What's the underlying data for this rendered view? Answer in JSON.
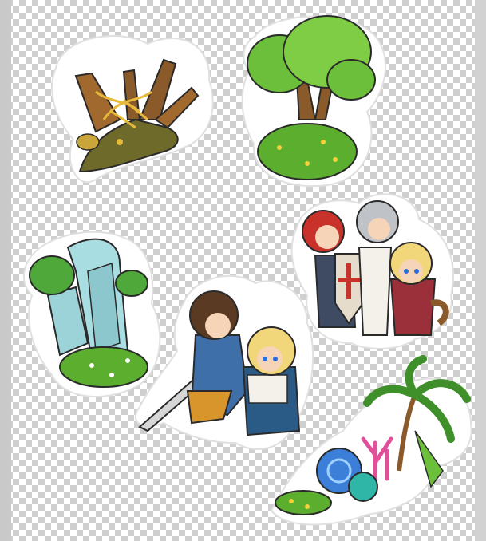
{
  "canvas": {
    "background": "transparency-checkerboard"
  },
  "stickers": [
    {
      "name": "dead-tree-stump-sticker",
      "icon": "withered-tree-icon"
    },
    {
      "name": "green-tree-bush-sticker",
      "icon": "tree-icon"
    },
    {
      "name": "knights-party-sticker",
      "icon": "characters-group-icon"
    },
    {
      "name": "overgrown-buildings-sticker",
      "icon": "ruined-skyscraper-icon"
    },
    {
      "name": "swordsman-and-girl-sticker",
      "icon": "adventurers-icon"
    },
    {
      "name": "coral-palm-sticker",
      "icon": "coral-reef-icon"
    }
  ],
  "colors": {
    "leaf": "#6cbf3a",
    "leaf_dark": "#3f8f2a",
    "bark": "#8a5a2b",
    "dead_wood": "#a2692f",
    "gold": "#e6b93b",
    "glass": "#9cd3d8",
    "hair_red": "#c8322b",
    "hair_silver": "#bfc3c8",
    "hair_blonde": "#f1d67a",
    "coral_pink": "#e24f9b",
    "coral_blue": "#3c7fd8",
    "outline": "#2a2a2a"
  }
}
